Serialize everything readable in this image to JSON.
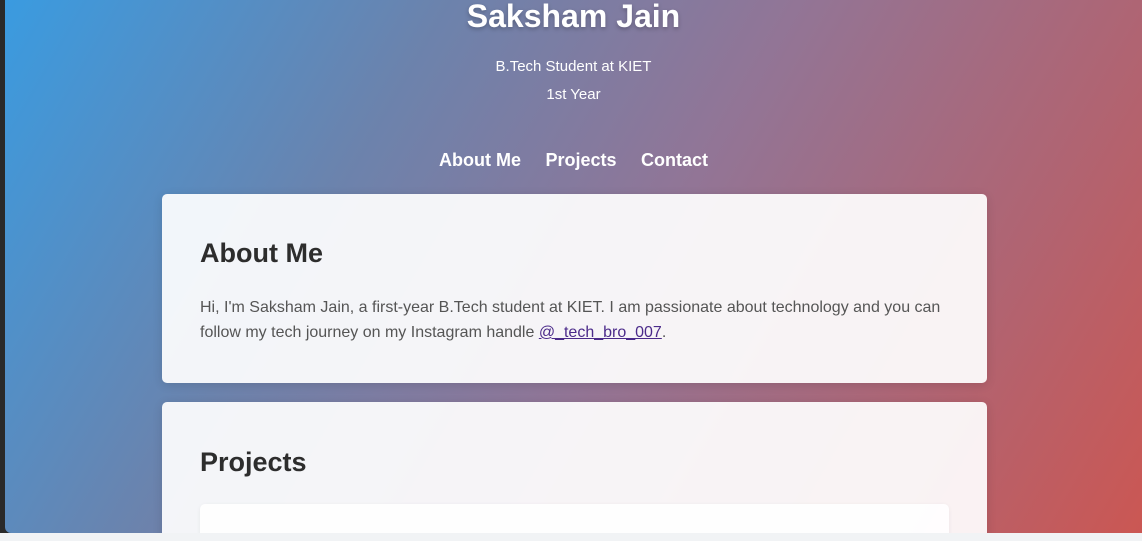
{
  "header": {
    "name": "Saksham Jain",
    "subtitle_line1": "B.Tech Student at KIET",
    "subtitle_line2": "1st Year"
  },
  "nav": {
    "items": [
      {
        "label": "About Me"
      },
      {
        "label": "Projects"
      },
      {
        "label": "Contact"
      }
    ]
  },
  "about": {
    "heading": "About Me",
    "text_before_link": "Hi, I'm Saksham Jain, a first-year B.Tech student at KIET. I am passionate about technology and you can follow my tech journey on my Instagram handle ",
    "link_text": "@_tech_bro_007",
    "text_after_link": "."
  },
  "projects": {
    "heading": "Projects"
  },
  "colors": {
    "gradient_start": "#3a9be0",
    "gradient_end": "#cb5753",
    "link": "#4b2a8a"
  }
}
